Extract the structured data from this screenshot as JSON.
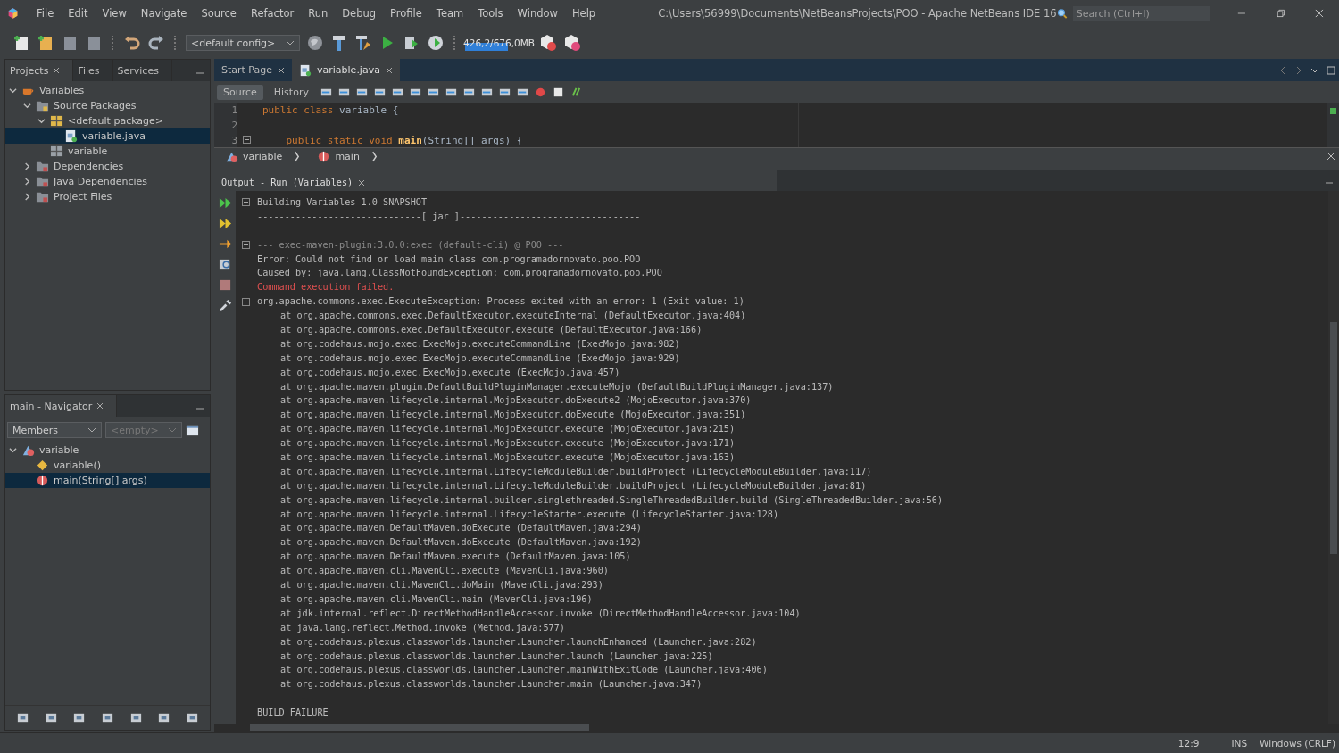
{
  "menu": [
    "File",
    "Edit",
    "View",
    "Navigate",
    "Source",
    "Refactor",
    "Run",
    "Debug",
    "Profile",
    "Team",
    "Tools",
    "Window",
    "Help"
  ],
  "window": {
    "title": "C:\\Users\\56999\\Documents\\NetBeansProjects\\POO - Apache NetBeans IDE 16"
  },
  "search": {
    "placeholder": "Search (Ctrl+I)"
  },
  "toolbar": {
    "config": "<default config>",
    "memory": {
      "reading": "426,2/676,0MB",
      "level": 0.63
    }
  },
  "project_tabs": [
    {
      "label": "Projects",
      "selected": true,
      "closable": true
    },
    {
      "label": "Files",
      "selected": false,
      "closable": false
    },
    {
      "label": "Services",
      "selected": false,
      "closable": false
    }
  ],
  "project_tree": [
    {
      "label": "Variables",
      "kind": "project",
      "expanded": true,
      "selected": false,
      "children": [
        {
          "label": "Source Packages",
          "kind": "folder",
          "expanded": true,
          "selected": false,
          "children": [
            {
              "label": "<default package>",
              "kind": "package",
              "expanded": true,
              "selected": false,
              "children": [
                {
                  "label": "variable.java",
                  "kind": "javafile",
                  "selected": true
                }
              ]
            },
            {
              "label": "variable",
              "kind": "greypackage",
              "selected": false
            }
          ]
        },
        {
          "label": "Dependencies",
          "kind": "depfolder",
          "expanded": false,
          "selected": false
        },
        {
          "label": "Java Dependencies",
          "kind": "depfolder",
          "expanded": false,
          "selected": false
        },
        {
          "label": "Project Files",
          "kind": "depfolder",
          "expanded": false,
          "selected": false
        }
      ]
    }
  ],
  "navigator": {
    "title": "main - Navigator",
    "filter": "Members",
    "second_filter": "<empty>",
    "tree": [
      {
        "label": "variable",
        "kind": "class",
        "expanded": true,
        "selected": false,
        "children": [
          {
            "label": "variable()",
            "kind": "constructor",
            "selected": false
          },
          {
            "label": "main(String[] args)",
            "kind": "method",
            "selected": true
          }
        ]
      }
    ]
  },
  "editor_tabs": [
    {
      "label": "Start Page",
      "selected": false
    },
    {
      "label": "variable.java",
      "selected": true
    }
  ],
  "editor_modes": [
    {
      "label": "Source",
      "selected": true
    },
    {
      "label": "History",
      "selected": false
    }
  ],
  "code": [
    {
      "number": "1",
      "fold": false,
      "tokens": [
        {
          "text": "public class",
          "kind": "keyword"
        },
        {
          "text": " variable {",
          "kind": "plain"
        }
      ]
    },
    {
      "number": "2",
      "fold": false
    },
    {
      "number": "3",
      "fold": true,
      "tokens": [
        {
          "text": "    public static void",
          "kind": "keyword"
        },
        {
          "text": " main",
          "kind": "method"
        },
        {
          "text": "(String[] args) {",
          "kind": "plain"
        }
      ]
    }
  ],
  "breadcrumb": [
    {
      "label": "variable",
      "kind": "class"
    },
    {
      "label": "main",
      "kind": "method"
    }
  ],
  "output": {
    "title": "Output - Run (Variables)",
    "lines": [
      {
        "text": "Building Variables 1.0-SNAPSHOT",
        "kind": "normal",
        "fold": true,
        "indent": false
      },
      {
        "text": "------------------------------[ jar ]---------------------------------",
        "kind": "normal",
        "fold": false,
        "indent": false
      },
      {
        "kind": "blank",
        "fold": false,
        "indent": false
      },
      {
        "text": "--- exec-maven-plugin:3.0.0:exec (default-cli) @ POO ---",
        "kind": "dim",
        "fold": true,
        "indent": false
      },
      {
        "text": "Error: Could not find or load main class com.programadornovato.poo.POO",
        "kind": "normal",
        "fold": false,
        "indent": false
      },
      {
        "text": "Caused by: java.lang.ClassNotFoundException: com.programadornovato.poo.POO",
        "kind": "normal",
        "fold": false,
        "indent": false
      },
      {
        "text": "Command execution failed.",
        "kind": "error",
        "fold": false,
        "indent": false
      },
      {
        "text": "org.apache.commons.exec.ExecuteException: Process exited with an error: 1 (Exit value: 1)",
        "kind": "normal",
        "fold": true,
        "indent": false
      },
      {
        "text": "at org.apache.commons.exec.DefaultExecutor.executeInternal (DefaultExecutor.java:404)",
        "kind": "normal",
        "fold": false,
        "indent": true
      },
      {
        "text": "at org.apache.commons.exec.DefaultExecutor.execute (DefaultExecutor.java:166)",
        "kind": "normal",
        "fold": false,
        "indent": true
      },
      {
        "text": "at org.codehaus.mojo.exec.ExecMojo.executeCommandLine (ExecMojo.java:982)",
        "kind": "normal",
        "fold": false,
        "indent": true
      },
      {
        "text": "at org.codehaus.mojo.exec.ExecMojo.executeCommandLine (ExecMojo.java:929)",
        "kind": "normal",
        "fold": false,
        "indent": true
      },
      {
        "text": "at org.codehaus.mojo.exec.ExecMojo.execute (ExecMojo.java:457)",
        "kind": "normal",
        "fold": false,
        "indent": true
      },
      {
        "text": "at org.apache.maven.plugin.DefaultBuildPluginManager.executeMojo (DefaultBuildPluginManager.java:137)",
        "kind": "normal",
        "fold": false,
        "indent": true
      },
      {
        "text": "at org.apache.maven.lifecycle.internal.MojoExecutor.doExecute2 (MojoExecutor.java:370)",
        "kind": "normal",
        "fold": false,
        "indent": true
      },
      {
        "text": "at org.apache.maven.lifecycle.internal.MojoExecutor.doExecute (MojoExecutor.java:351)",
        "kind": "normal",
        "fold": false,
        "indent": true
      },
      {
        "text": "at org.apache.maven.lifecycle.internal.MojoExecutor.execute (MojoExecutor.java:215)",
        "kind": "normal",
        "fold": false,
        "indent": true
      },
      {
        "text": "at org.apache.maven.lifecycle.internal.MojoExecutor.execute (MojoExecutor.java:171)",
        "kind": "normal",
        "fold": false,
        "indent": true
      },
      {
        "text": "at org.apache.maven.lifecycle.internal.MojoExecutor.execute (MojoExecutor.java:163)",
        "kind": "normal",
        "fold": false,
        "indent": true
      },
      {
        "text": "at org.apache.maven.lifecycle.internal.LifecycleModuleBuilder.buildProject (LifecycleModuleBuilder.java:117)",
        "kind": "normal",
        "fold": false,
        "indent": true
      },
      {
        "text": "at org.apache.maven.lifecycle.internal.LifecycleModuleBuilder.buildProject (LifecycleModuleBuilder.java:81)",
        "kind": "normal",
        "fold": false,
        "indent": true
      },
      {
        "text": "at org.apache.maven.lifecycle.internal.builder.singlethreaded.SingleThreadedBuilder.build (SingleThreadedBuilder.java:56)",
        "kind": "normal",
        "fold": false,
        "indent": true
      },
      {
        "text": "at org.apache.maven.lifecycle.internal.LifecycleStarter.execute (LifecycleStarter.java:128)",
        "kind": "normal",
        "fold": false,
        "indent": true
      },
      {
        "text": "at org.apache.maven.DefaultMaven.doExecute (DefaultMaven.java:294)",
        "kind": "normal",
        "fold": false,
        "indent": true
      },
      {
        "text": "at org.apache.maven.DefaultMaven.doExecute (DefaultMaven.java:192)",
        "kind": "normal",
        "fold": false,
        "indent": true
      },
      {
        "text": "at org.apache.maven.DefaultMaven.execute (DefaultMaven.java:105)",
        "kind": "normal",
        "fold": false,
        "indent": true
      },
      {
        "text": "at org.apache.maven.cli.MavenCli.execute (MavenCli.java:960)",
        "kind": "normal",
        "fold": false,
        "indent": true
      },
      {
        "text": "at org.apache.maven.cli.MavenCli.doMain (MavenCli.java:293)",
        "kind": "normal",
        "fold": false,
        "indent": true
      },
      {
        "text": "at org.apache.maven.cli.MavenCli.main (MavenCli.java:196)",
        "kind": "normal",
        "fold": false,
        "indent": true
      },
      {
        "text": "at jdk.internal.reflect.DirectMethodHandleAccessor.invoke (DirectMethodHandleAccessor.java:104)",
        "kind": "normal",
        "fold": false,
        "indent": true
      },
      {
        "text": "at java.lang.reflect.Method.invoke (Method.java:577)",
        "kind": "normal",
        "fold": false,
        "indent": true
      },
      {
        "text": "at org.codehaus.plexus.classworlds.launcher.Launcher.launchEnhanced (Launcher.java:282)",
        "kind": "normal",
        "fold": false,
        "indent": true
      },
      {
        "text": "at org.codehaus.plexus.classworlds.launcher.Launcher.launch (Launcher.java:225)",
        "kind": "normal",
        "fold": false,
        "indent": true
      },
      {
        "text": "at org.codehaus.plexus.classworlds.launcher.Launcher.mainWithExitCode (Launcher.java:406)",
        "kind": "normal",
        "fold": false,
        "indent": true
      },
      {
        "text": "at org.codehaus.plexus.classworlds.launcher.Launcher.main (Launcher.java:347)",
        "kind": "normal",
        "fold": false,
        "indent": true
      },
      {
        "text": "------------------------------------------------------------------------",
        "kind": "normal",
        "fold": false,
        "indent": false
      },
      {
        "text": "BUILD FAILURE",
        "kind": "normal",
        "fold": false,
        "indent": false
      }
    ]
  },
  "status_bar": {
    "position": "12:9",
    "mode": "INS",
    "line_endings": "Windows (CRLF)"
  }
}
